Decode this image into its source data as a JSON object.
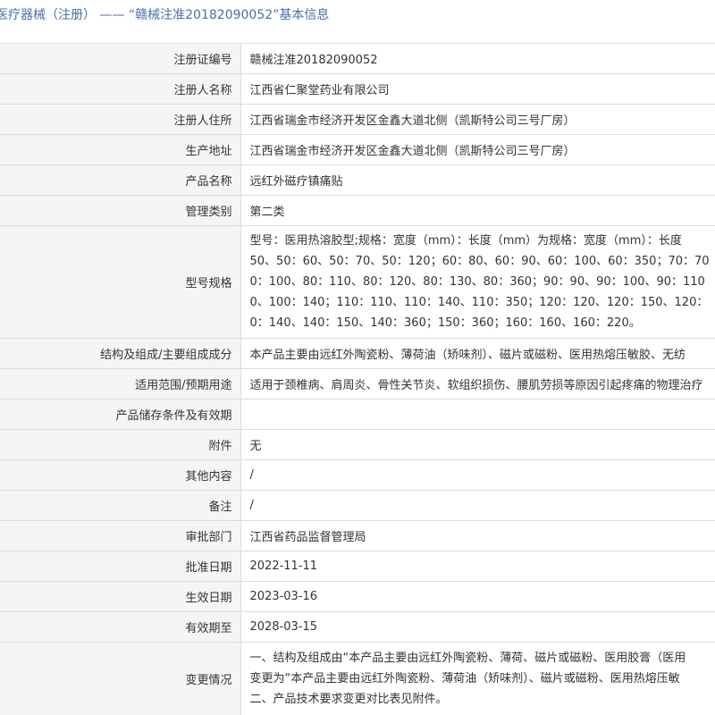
{
  "header": {
    "title": "医疗器械（注册） —— “赣械注准20182090052”基本信息"
  },
  "rows": [
    {
      "label": "注册证编号",
      "value": "赣械注准20182090052"
    },
    {
      "label": "注册人名称",
      "value": "江西省仁聚堂药业有限公司"
    },
    {
      "label": "注册人住所",
      "value": "江西省瑞金市经济开发区金鑫大道北侧（凯斯特公司三号厂房）"
    },
    {
      "label": "生产地址",
      "value": "江西省瑞金市经济开发区金鑫大道北侧（凯斯特公司三号厂房）"
    },
    {
      "label": "产品名称",
      "value": "远红外磁疗镇痛贴"
    },
    {
      "label": "管理类别",
      "value": "第二类"
    },
    {
      "label": "型号规格",
      "lines": [
        "型号：医用热溶胶型;规格：宽度（mm）：长度（mm）为规格：宽度（mm）：长度",
        "50、50：60、50：70、50：120；60：80、60：90、60：100、60：350；70：70",
        "0：100、80：110、80：120、80：130、80：360；90：90、90：100、90：110",
        "0、100：140；110：110、110：140、110：350；120：120、120：150、120：",
        "0：140、140：150、140：360；150：360；160：160、160：220。"
      ]
    },
    {
      "label": "结构及组成/主要组成成分",
      "value": "本产品主要由远红外陶瓷粉、薄荷油（矫味剂）、磁片或磁粉、医用热熔压敏胶、无纺"
    },
    {
      "label": "适用范围/预期用途",
      "value": "适用于颈椎病、肩周炎、骨性关节炎、软组织损伤、腰肌劳损等原因引起疼痛的物理治疗"
    },
    {
      "label": "产品储存条件及有效期",
      "value": ""
    },
    {
      "label": "附件",
      "value": "无"
    },
    {
      "label": "其他内容",
      "value": "/"
    },
    {
      "label": "备注",
      "value": "/"
    },
    {
      "label": "审批部门",
      "value": "江西省药品监督管理局"
    },
    {
      "label": "批准日期",
      "value": "2022-11-11"
    },
    {
      "label": "生效日期",
      "value": "2023-03-16"
    },
    {
      "label": "有效期至",
      "value": "2028-03-15"
    },
    {
      "label": "变更情况",
      "lines": [
        "一、结构及组成由“本产品主要由远红外陶瓷粉、薄荷、磁片或磁粉、医用胶膏（医用",
        "变更为“本产品主要由远红外陶瓷粉、薄荷油（矫味剂）、磁片或磁粉、医用热熔压敏",
        "二、产品技术要求变更对比表见附件。"
      ]
    }
  ]
}
